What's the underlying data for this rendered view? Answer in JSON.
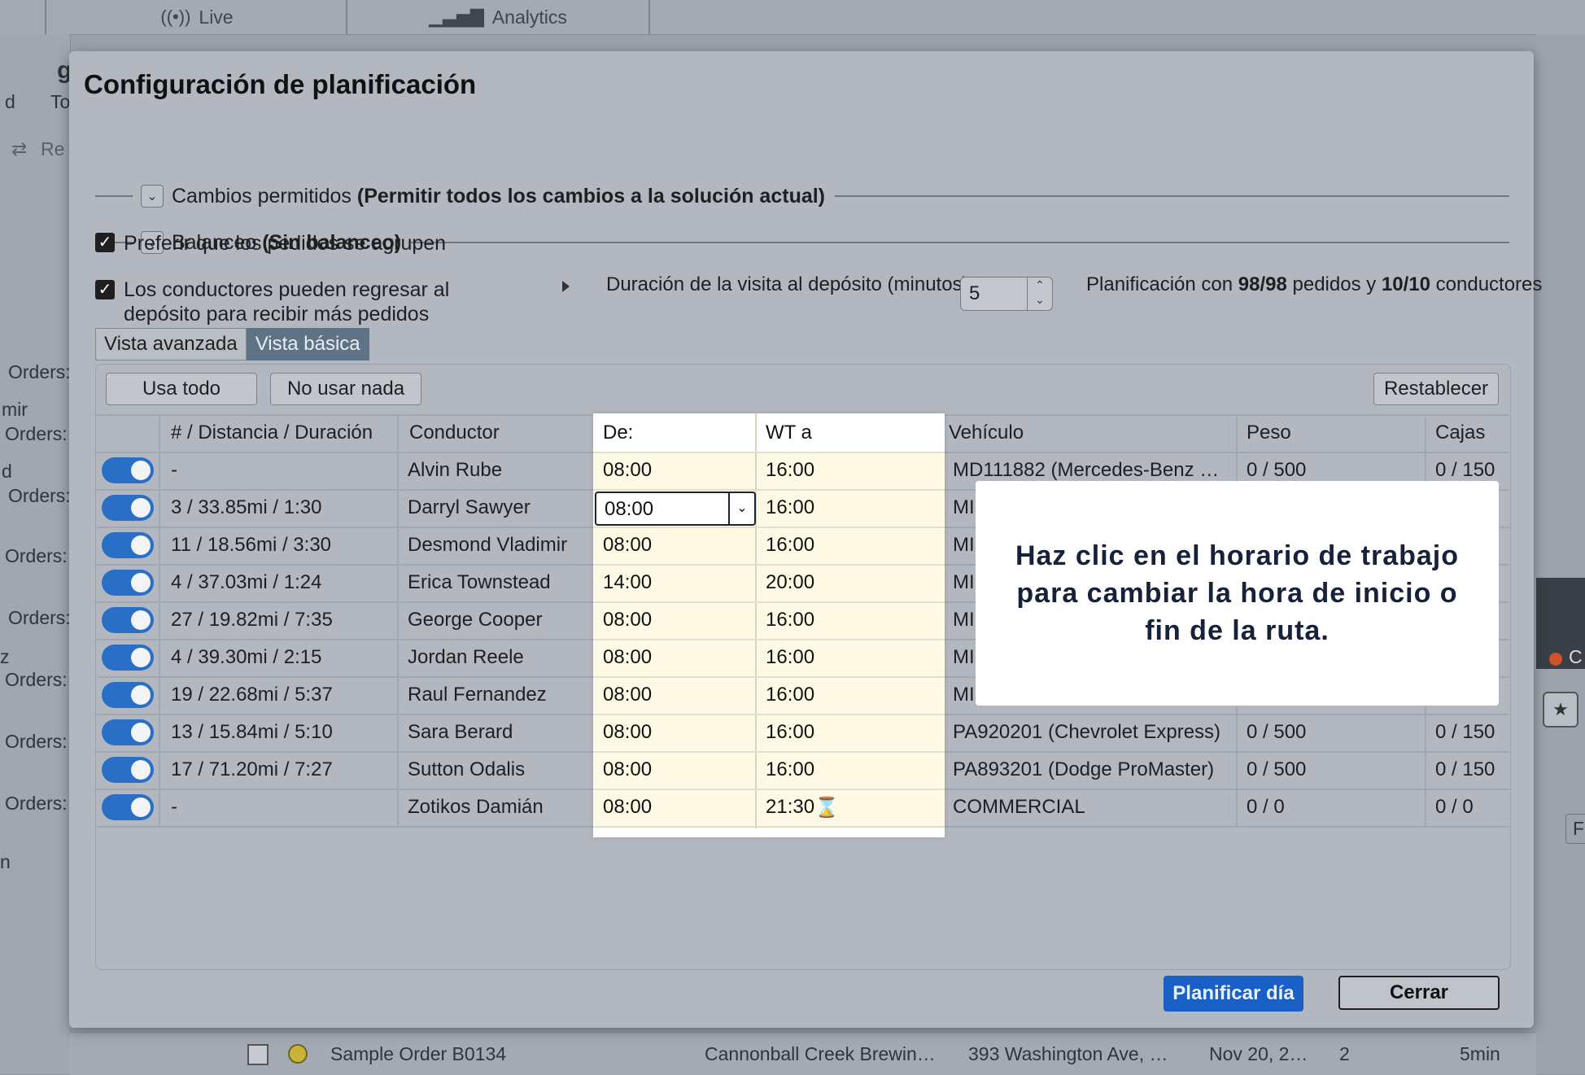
{
  "background": {
    "tabs": [
      {
        "label": "Live",
        "icon": "broadcast-icon"
      },
      {
        "label": "Analytics",
        "icon": "bar-chart-icon"
      }
    ],
    "sidebar_fragments": [
      "g",
      "d",
      "To",
      "Re",
      "Orders:",
      "mir",
      "Orders:",
      "d",
      "Orders:",
      "Orders:",
      "Orders:",
      "z",
      "Orders:",
      "Orders:",
      "Orders:",
      "n"
    ],
    "bottom_row": {
      "order": "Sample Order B0134",
      "customer": "Cannonball Creek Brewin…",
      "address": "393 Washington Ave, …",
      "date": "Nov 20, 2…",
      "count": "2",
      "duration": "5min"
    },
    "right_fragments": [
      "C",
      "Fi"
    ]
  },
  "modal": {
    "title": "Configuración de planificación",
    "sections": [
      {
        "label": "Cambios permitidos",
        "value": "(Permitir todos los cambios a la solución actual)"
      },
      {
        "label": "Balanceo",
        "value": "(Sin balanceo)"
      }
    ],
    "prefer_grouping": {
      "label": "Preferir que los pedidos se agrupen",
      "checked": true
    },
    "drivers_return": {
      "label_line1": "Los conductores pueden regresar al",
      "label_line2": "depósito para recibir más pedidos",
      "checked": true
    },
    "depot_visit": {
      "label": "Duración de la visita al depósito (minutos):",
      "value": "5"
    },
    "plan_status": {
      "prefix": "Planificación con ",
      "orders": "98/98",
      "middle": " pedidos y ",
      "drivers": "10/10",
      "suffix": " conductores"
    },
    "view_tabs": [
      "Vista avanzada",
      "Vista básica"
    ],
    "buttons": {
      "use_all": "Usa todo",
      "use_none": "No usar nada",
      "reset": "Restablecer",
      "plan_day": "Planificar día",
      "close": "Cerrar"
    },
    "columns": [
      "# / Distancia / Duración",
      "Conductor",
      "De:",
      "WT a",
      "Vehículo",
      "Peso",
      "Cajas"
    ],
    "rows": [
      {
        "stats": "-",
        "driver": "Alvin Rube",
        "from": "08:00",
        "to": "16:00",
        "vehicle": "MD111882 (Mercedes-Benz …",
        "weight": "0 / 500",
        "boxes": "0 / 150"
      },
      {
        "stats": "3 / 33.85mi / 1:30",
        "driver": "Darryl Sawyer",
        "from": "08:00",
        "to": "16:00",
        "vehicle": "MI",
        "weight": "",
        "boxes": ""
      },
      {
        "stats": "11 / 18.56mi / 3:30",
        "driver": "Desmond Vladimir",
        "from": "08:00",
        "to": "16:00",
        "vehicle": "MI",
        "weight": "",
        "boxes": ""
      },
      {
        "stats": "4 / 37.03mi / 1:24",
        "driver": "Erica Townstead",
        "from": "14:00",
        "to": "20:00",
        "vehicle": "MI",
        "weight": "",
        "boxes": ""
      },
      {
        "stats": "27 / 19.82mi / 7:35",
        "driver": "George Cooper",
        "from": "08:00",
        "to": "16:00",
        "vehicle": "MI",
        "weight": "",
        "boxes": ""
      },
      {
        "stats": "4 / 39.30mi / 2:15",
        "driver": "Jordan Reele",
        "from": "08:00",
        "to": "16:00",
        "vehicle": "MI",
        "weight": "",
        "boxes": ""
      },
      {
        "stats": "19 / 22.68mi / 5:37",
        "driver": "Raul Fernandez",
        "from": "08:00",
        "to": "16:00",
        "vehicle": "MI",
        "weight": "",
        "boxes": ""
      },
      {
        "stats": "13 / 15.84mi / 5:10",
        "driver": "Sara Berard",
        "from": "08:00",
        "to": "16:00",
        "vehicle": "PA920201 (Chevrolet Express)",
        "weight": "0 / 500",
        "boxes": "0 / 150"
      },
      {
        "stats": "17 / 71.20mi / 7:27",
        "driver": "Sutton Odalis",
        "from": "08:00",
        "to": "16:00",
        "vehicle": "PA893201 (Dodge ProMaster)",
        "weight": "0 / 500",
        "boxes": "0 / 150"
      },
      {
        "stats": "-",
        "driver": "Zotikos Damián",
        "from": "08:00",
        "to": "21:30",
        "vehicle": "COMMERCIAL",
        "weight": "0 / 0",
        "boxes": "0 / 0"
      }
    ],
    "hourglass_icon": "⌛",
    "tooltip": "Haz clic en el horario de trabajo para cambiar la hora de inicio o fin de la ruta."
  }
}
